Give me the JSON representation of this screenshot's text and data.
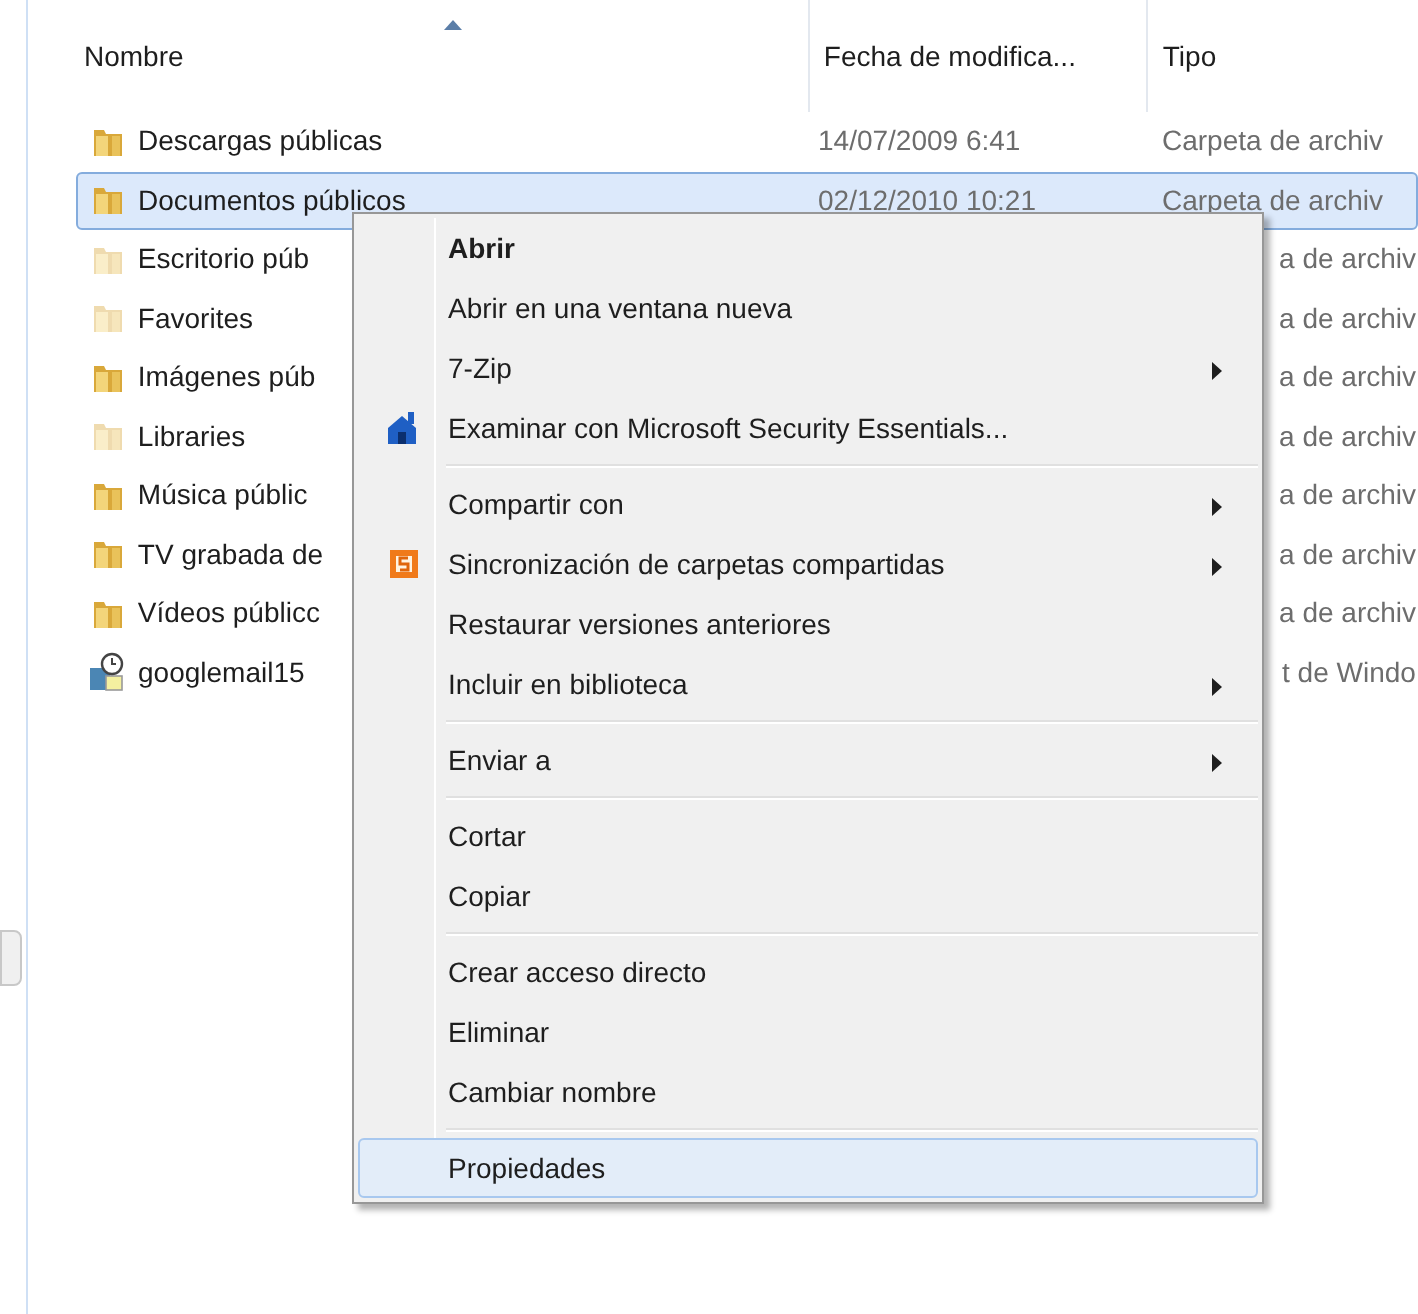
{
  "columns": [
    {
      "label": "Nombre",
      "sorted": true
    },
    {
      "label": "Fecha de modifica...",
      "sorted": false
    },
    {
      "label": "Tipo",
      "sorted": false
    }
  ],
  "rows": [
    {
      "name": "Descargas públicas",
      "date": "14/07/2009 6:41",
      "type": "Carpeta de archiv",
      "kind": "folder",
      "hidden": false,
      "selected": false
    },
    {
      "name": "Documentos públicos",
      "date": "02/12/2010 10:21",
      "type": "Carpeta de archiv",
      "kind": "folder",
      "hidden": false,
      "selected": true
    },
    {
      "name": "Escritorio púb",
      "type": "a de archiv",
      "kind": "folder",
      "hidden": true,
      "selected": false
    },
    {
      "name": "Favorites",
      "type": "a de archiv",
      "kind": "folder",
      "hidden": true,
      "selected": false
    },
    {
      "name": "Imágenes púb",
      "type": "a de archiv",
      "kind": "folder",
      "hidden": false,
      "selected": false
    },
    {
      "name": "Libraries",
      "type": "a de archiv",
      "kind": "folder",
      "hidden": true,
      "selected": false
    },
    {
      "name": "Música públic",
      "type": "a de archiv",
      "kind": "folder",
      "hidden": false,
      "selected": false
    },
    {
      "name": "TV grabada de",
      "type": "a de archiv",
      "kind": "folder",
      "hidden": false,
      "selected": false
    },
    {
      "name": "Vídeos públicc",
      "type": "a de archiv",
      "kind": "folder",
      "hidden": false,
      "selected": false
    },
    {
      "name": "googlemail15",
      "type": "t de Windo",
      "kind": "file",
      "hidden": false,
      "selected": false
    }
  ],
  "menu": [
    [
      {
        "label": "Abrir",
        "default": true,
        "submenu": false,
        "selected": false
      },
      {
        "label": "Abrir en una ventana nueva",
        "default": false,
        "submenu": false,
        "selected": false
      },
      {
        "label": "7-Zip",
        "default": false,
        "submenu": true,
        "selected": false
      },
      {
        "label": "Examinar con Microsoft Security Essentials...",
        "default": false,
        "submenu": false,
        "selected": false
      }
    ],
    [
      {
        "label": "Compartir con",
        "default": false,
        "submenu": true,
        "selected": false
      },
      {
        "label": "Sincronización de carpetas compartidas",
        "default": false,
        "submenu": true,
        "selected": false
      },
      {
        "label": "Restaurar versiones anteriores",
        "default": false,
        "submenu": false,
        "selected": false
      },
      {
        "label": "Incluir en biblioteca",
        "default": false,
        "submenu": true,
        "selected": false
      }
    ],
    [
      {
        "label": "Enviar a",
        "default": false,
        "submenu": true,
        "selected": false
      }
    ],
    [
      {
        "label": "Cortar",
        "default": false,
        "submenu": false,
        "selected": false
      },
      {
        "label": "Copiar",
        "default": false,
        "submenu": false,
        "selected": false
      }
    ],
    [
      {
        "label": "Crear acceso directo",
        "default": false,
        "submenu": false,
        "selected": false
      },
      {
        "label": "Eliminar",
        "default": false,
        "submenu": false,
        "selected": false
      },
      {
        "label": "Cambiar nombre",
        "default": false,
        "submenu": false,
        "selected": false
      }
    ],
    [
      {
        "label": "Propiedades",
        "default": false,
        "submenu": false,
        "selected": true
      }
    ]
  ]
}
